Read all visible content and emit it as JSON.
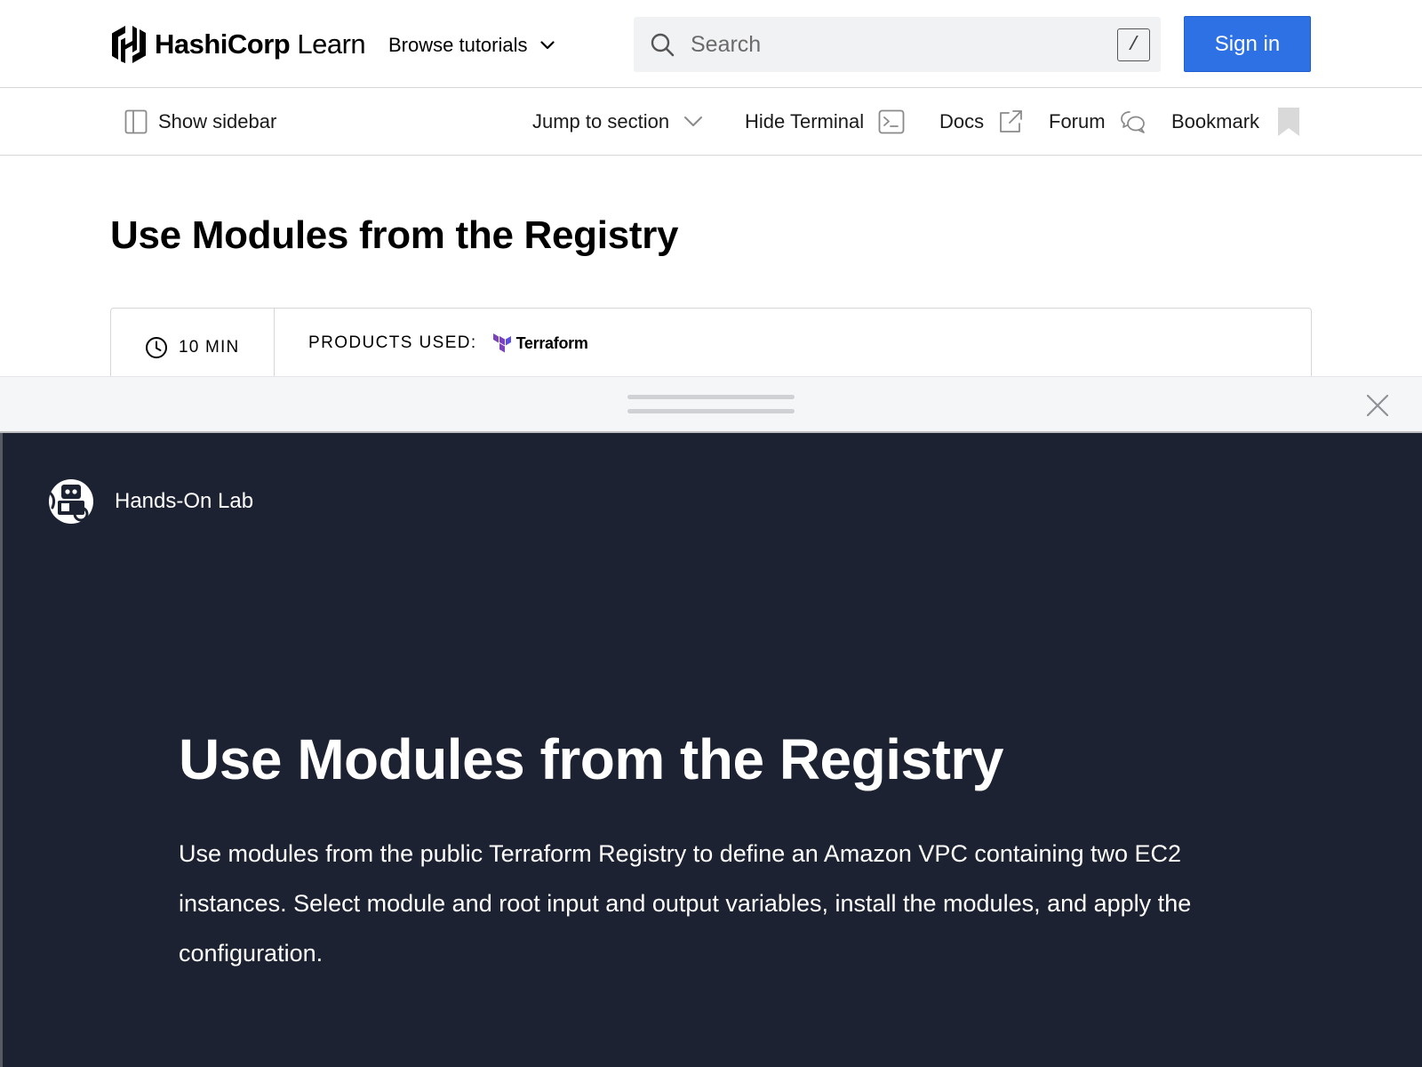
{
  "header": {
    "logo_brand": "HashiCorp",
    "logo_product": "Learn",
    "browse_label": "Browse tutorials",
    "search_placeholder": "Search",
    "search_shortcut": "/",
    "signin_label": "Sign in"
  },
  "toolbar": {
    "show_sidebar_label": "Show sidebar",
    "jump_label": "Jump to section",
    "hide_terminal_label": "Hide Terminal",
    "docs_label": "Docs",
    "forum_label": "Forum",
    "bookmark_label": "Bookmark"
  },
  "tutorial": {
    "title": "Use Modules from the Registry",
    "duration": "10 MIN",
    "products_label": "PRODUCTS USED:",
    "product_name": "Terraform"
  },
  "lab": {
    "label": "Hands-On Lab",
    "title": "Use Modules from the Registry",
    "description": "Use modules from the public Terraform Registry to define an Amazon VPC containing two EC2 instances. Select module and root input and output variables, install the modules, and apply the configuration."
  },
  "colors": {
    "accent": "#2e71e5",
    "lab_background": "#1d2232",
    "terraform_purple": "#7b42bc"
  },
  "icons": {
    "logo": "hashicorp-logo-icon",
    "browse": "chevron-down-icon",
    "search": "search-icon",
    "sidebar": "sidebar-icon",
    "jump": "chevron-down-icon",
    "terminal": "terminal-icon",
    "docs": "external-link-icon",
    "forum": "chat-bubbles-icon",
    "bookmark": "bookmark-icon",
    "clock": "clock-icon",
    "terraform": "terraform-logo-icon",
    "close": "close-icon",
    "lab": "hands-on-lab-icon"
  }
}
